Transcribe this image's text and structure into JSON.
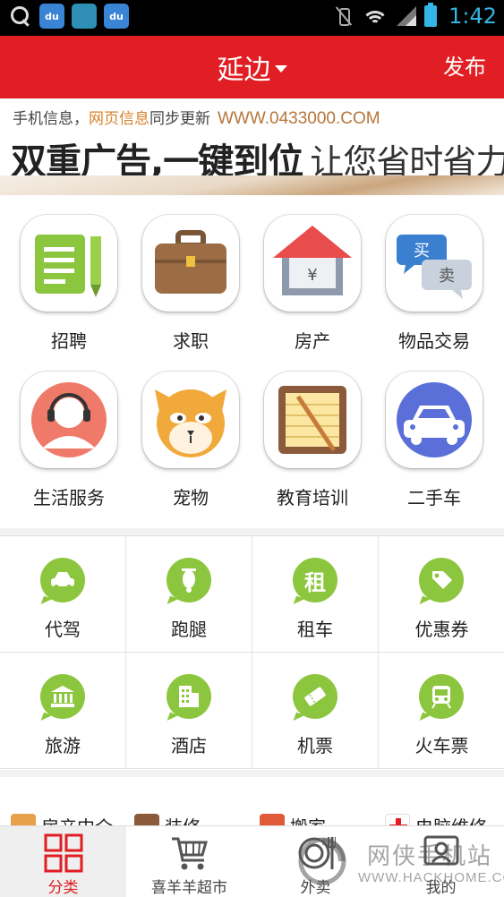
{
  "status_bar": {
    "time": "1:42",
    "notif_icons": [
      "search-icon",
      "baidu-icon",
      "app-icon",
      "baidu-icon"
    ],
    "notif_labels": [
      "",
      "du",
      "",
      "du"
    ],
    "accent": "#33b5e5"
  },
  "header": {
    "city": "延边",
    "publish_label": "发布",
    "color": "#e01e23"
  },
  "banner": {
    "line1_a": "手机信息，",
    "line1_b": "网页信息",
    "line1_c": "同步更新",
    "url": "WWW.0433000.COM",
    "headline": "双重广告,一键到位",
    "subline": "让您省时省力"
  },
  "categories": [
    {
      "label": "招聘",
      "icon": "document-pencil-icon"
    },
    {
      "label": "求职",
      "icon": "briefcase-icon"
    },
    {
      "label": "房产",
      "icon": "house-icon"
    },
    {
      "label": "物品交易",
      "icon": "buy-sell-icon"
    },
    {
      "label": "生活服务",
      "icon": "headset-person-icon"
    },
    {
      "label": "宠物",
      "icon": "cat-icon"
    },
    {
      "label": "教育培训",
      "icon": "notebook-pen-icon"
    },
    {
      "label": "二手车",
      "icon": "car-icon"
    }
  ],
  "services": [
    {
      "label": "代驾",
      "icon": "car-icon"
    },
    {
      "label": "跑腿",
      "icon": "scooter-icon"
    },
    {
      "label": "租车",
      "icon": "rent-icon",
      "glyph": "租"
    },
    {
      "label": "优惠券",
      "icon": "tag-icon"
    },
    {
      "label": "旅游",
      "icon": "temple-icon"
    },
    {
      "label": "酒店",
      "icon": "hotel-icon"
    },
    {
      "label": "机票",
      "icon": "ticket-icon"
    },
    {
      "label": "火车票",
      "icon": "train-icon"
    }
  ],
  "strip": [
    {
      "label": "房产中介",
      "icon": "house-icon"
    },
    {
      "label": "装修",
      "icon": "house-icon"
    },
    {
      "label": "搬家",
      "icon": "moving-icon"
    },
    {
      "label": "电脑维修",
      "icon": "medical-cross-icon"
    }
  ],
  "tabs": [
    {
      "label": "分类",
      "icon": "grid-icon",
      "active": true
    },
    {
      "label": "喜羊羊超市",
      "icon": "cart-icon",
      "active": false
    },
    {
      "label": "外卖",
      "icon": "plate-fork-icon",
      "active": false
    },
    {
      "label": "我的",
      "icon": "person-icon",
      "active": false
    }
  ],
  "watermark": {
    "text": "网侠手机站",
    "url": "WWW.HACKHOME.COM"
  }
}
